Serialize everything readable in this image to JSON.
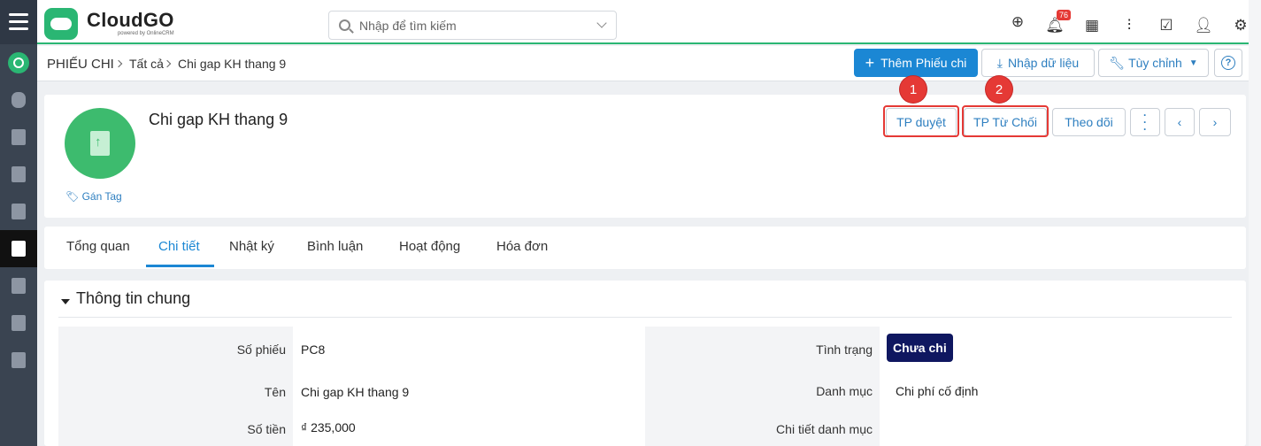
{
  "app": {
    "logo_name": "CloudGO",
    "logo_sub": "powered by OnlineCRM"
  },
  "search": {
    "placeholder": "Nhập để tìm kiếm"
  },
  "notifications": {
    "count": "76"
  },
  "breadcrumb": {
    "module": "PHIẾU CHI",
    "level1": "Tất cả",
    "current": "Chi gap KH thang 9"
  },
  "actions": {
    "add": "Thêm Phiếu chi",
    "import": "Nhập dữ liệu",
    "customize": "Tùy chỉnh",
    "help": "?"
  },
  "record": {
    "title": "Chi gap KH thang 9",
    "tag_label": "Gán Tag",
    "buttons": {
      "approve": "TP duyệt",
      "reject": "TP Từ Chối",
      "follow": "Theo dõi"
    },
    "annotations": [
      "1",
      "2"
    ]
  },
  "tabs": [
    {
      "label": "Tổng quan"
    },
    {
      "label": "Chi tiết"
    },
    {
      "label": "Nhật ký"
    },
    {
      "label": "Bình luận"
    },
    {
      "label": "Hoạt động"
    },
    {
      "label": "Hóa đơn"
    }
  ],
  "section": {
    "title": "Thông tin chung",
    "left": [
      {
        "label": "Số phiếu",
        "value": "PC8"
      },
      {
        "label": "Tên",
        "value": "Chi gap KH thang 9"
      },
      {
        "label": "Số tiền",
        "value": "₫ 235,000"
      }
    ],
    "right": [
      {
        "label": "Tình trạng",
        "value": "Chưa chi"
      },
      {
        "label": "Danh mục",
        "value": "Chi phí cố định"
      },
      {
        "label": "Chi tiết danh mục",
        "value": ""
      }
    ]
  },
  "colors": {
    "brand_green": "#2ab673",
    "primary_blue": "#1b87d4",
    "status_navy": "#0f1760",
    "annotation_red": "#e53935"
  }
}
